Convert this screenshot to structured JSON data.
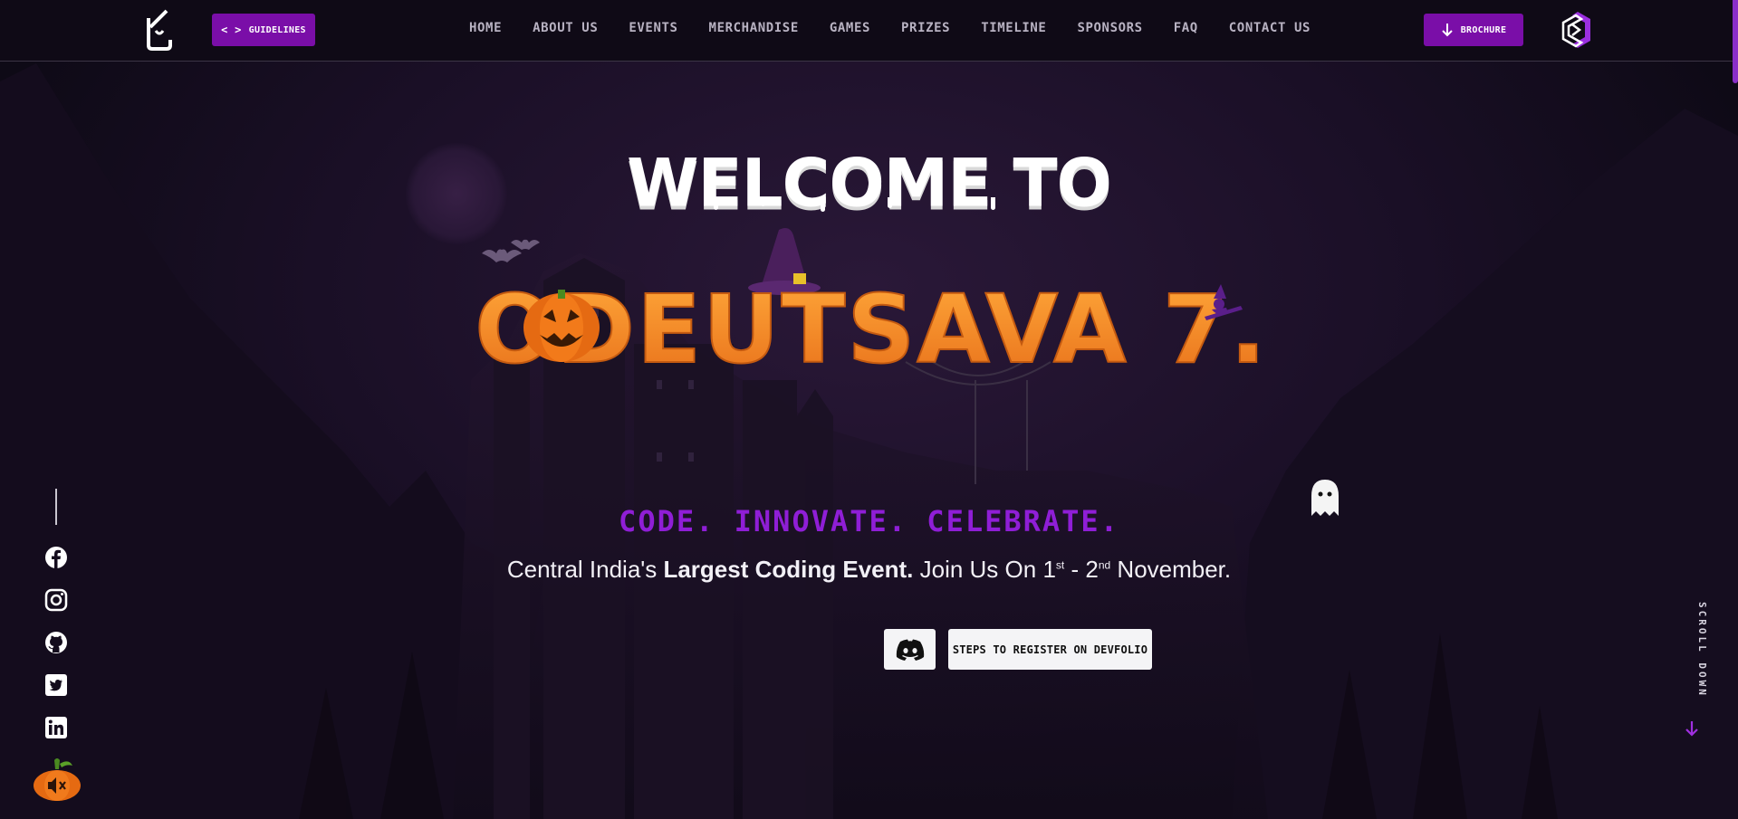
{
  "navbar": {
    "guidelines_label": "GUIDELINES",
    "brochure_label": "BROCHURE",
    "links": [
      "HOME",
      "ABOUT US",
      "EVENTS",
      "MERCHANDISE",
      "GAMES",
      "PRIZES",
      "TIMELINE",
      "SPONSORS",
      "FAQ",
      "CONTACT US"
    ]
  },
  "hero": {
    "welcome": "WELCOME TO",
    "title": "CODEUTSAVA 7.0",
    "tagline": "CODE. INNOVATE. CELEBRATE.",
    "subline_pre": "Central India's ",
    "subline_bold": "Largest Coding Event.",
    "subline_mid": " Join Us On 1",
    "subline_sup1": "st",
    "subline_dash": " - 2",
    "subline_sup2": "nd",
    "subline_post": " November.",
    "register_label": "STEPS TO REGISTER ON DEVFOLIO"
  },
  "social": {
    "icons": [
      "facebook-icon",
      "instagram-icon",
      "github-icon",
      "twitter-icon",
      "linkedin-icon"
    ]
  },
  "scroll": {
    "label": "SCROLL DOWN"
  },
  "colors": {
    "accent_purple": "#7a0ea8",
    "tagline_purple": "#8f1ed6",
    "title_orange": "#f7901e",
    "background": "#1a0f26"
  }
}
